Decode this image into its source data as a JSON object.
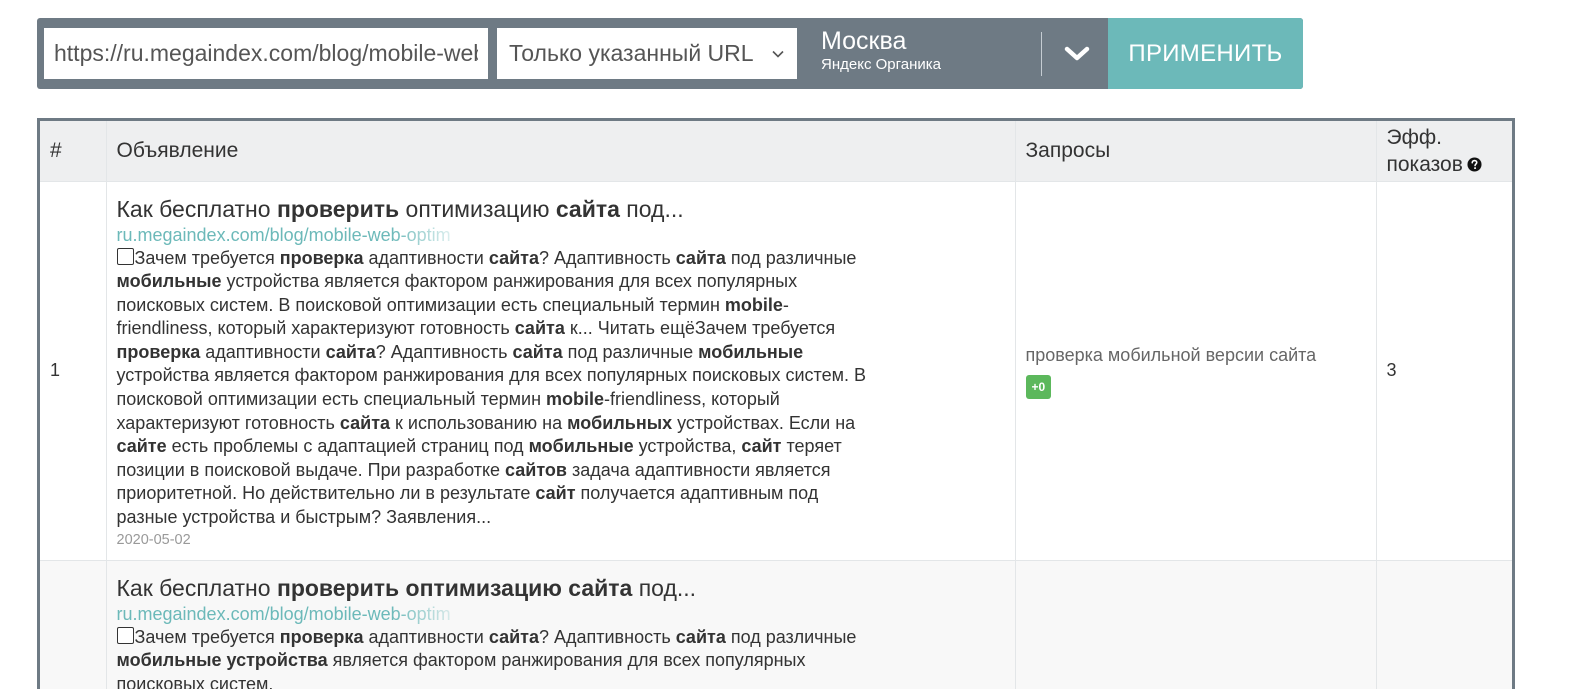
{
  "toolbar": {
    "url_value": "https://ru.megaindex.com/blog/mobile-web-optimization",
    "scope_label": "Только указанный URL",
    "region_city": "Москва",
    "region_engine": "Яндекс Органика",
    "apply_label": "ПРИМЕНИТЬ",
    "colors": {
      "bar": "#6e7a84",
      "accent": "#6cb9b9",
      "badge": "#5cb85c"
    }
  },
  "table": {
    "columns": {
      "num": "#",
      "ad": "Объявление",
      "queries": "Запросы",
      "eff_line1": "Эфф.",
      "eff_line2": "показов"
    },
    "rows": [
      {
        "num": "1",
        "title": [
          {
            "t": "Как бесплатно ",
            "b": false
          },
          {
            "t": "проверить",
            "b": true
          },
          {
            "t": " оптимизацию ",
            "b": false
          },
          {
            "t": "сайта",
            "b": true
          },
          {
            "t": " под...",
            "b": false
          }
        ],
        "url": "ru.megaindex.com/blog/mobile-web-optim",
        "text": [
          {
            "t": "Зачем требуется ",
            "b": false
          },
          {
            "t": "проверка",
            "b": true
          },
          {
            "t": " адаптивности ",
            "b": false
          },
          {
            "t": "сайта",
            "b": true
          },
          {
            "t": "? Адаптивность ",
            "b": false
          },
          {
            "t": "сайта",
            "b": true
          },
          {
            "t": " под различные ",
            "b": false
          },
          {
            "t": "мобильные",
            "b": true
          },
          {
            "t": " устройства является фактором ранжирования для всех популярных поисковых систем. В поисковой оптимизации есть специальный термин ",
            "b": false
          },
          {
            "t": "mobile",
            "b": true
          },
          {
            "t": "-friendliness, который характеризуют готовность ",
            "b": false
          },
          {
            "t": "сайта",
            "b": true
          },
          {
            "t": " к... Читать ещёЗачем требуется ",
            "b": false
          },
          {
            "t": "проверка",
            "b": true
          },
          {
            "t": " адаптивности ",
            "b": false
          },
          {
            "t": "сайта",
            "b": true
          },
          {
            "t": "? Адаптивность ",
            "b": false
          },
          {
            "t": "сайта",
            "b": true
          },
          {
            "t": " под различные ",
            "b": false
          },
          {
            "t": "мобильные",
            "b": true
          },
          {
            "t": " устройства является фактором ранжирования для всех популярных поисковых систем. В поисковой оптимизации есть специальный термин ",
            "b": false
          },
          {
            "t": "mobile",
            "b": true
          },
          {
            "t": "-friendliness, который характеризуют готовность ",
            "b": false
          },
          {
            "t": "сайта",
            "b": true
          },
          {
            "t": " к использованию на ",
            "b": false
          },
          {
            "t": "мобильных",
            "b": true
          },
          {
            "t": " устройствах. Если на ",
            "b": false
          },
          {
            "t": "сайте",
            "b": true
          },
          {
            "t": " есть проблемы с адаптацией страниц под ",
            "b": false
          },
          {
            "t": "мобильные",
            "b": true
          },
          {
            "t": " устройства, ",
            "b": false
          },
          {
            "t": "сайт",
            "b": true
          },
          {
            "t": " теряет позиции в поисковой выдаче. При разработке ",
            "b": false
          },
          {
            "t": "сайтов",
            "b": true
          },
          {
            "t": " задача адаптивности является приоритетной. Но действительно ли в результате ",
            "b": false
          },
          {
            "t": "сайт",
            "b": true
          },
          {
            "t": " получается адаптивным под разные устройства и быстрым? Заявления...",
            "b": false
          }
        ],
        "date": "2020-05-02",
        "query": "проверка мобильной версии сайта",
        "delta": "+0",
        "eff": "3"
      },
      {
        "num": "",
        "title": [
          {
            "t": "Как бесплатно ",
            "b": false
          },
          {
            "t": "проверить оптимизацию сайта",
            "b": true
          },
          {
            "t": " под...",
            "b": false
          }
        ],
        "url": "ru.megaindex.com/blog/mobile-web-optim",
        "text": [
          {
            "t": "Зачем требуется ",
            "b": false
          },
          {
            "t": "проверка",
            "b": true
          },
          {
            "t": " адаптивности ",
            "b": false
          },
          {
            "t": "сайта",
            "b": true
          },
          {
            "t": "? Адаптивность ",
            "b": false
          },
          {
            "t": "сайта",
            "b": true
          },
          {
            "t": " под различные ",
            "b": false
          },
          {
            "t": "мобильные устройства",
            "b": true
          },
          {
            "t": " является фактором ранжирования для всех популярных поисковых систем.",
            "b": false
          }
        ],
        "date": "",
        "query": "",
        "delta": "",
        "eff": ""
      }
    ]
  }
}
